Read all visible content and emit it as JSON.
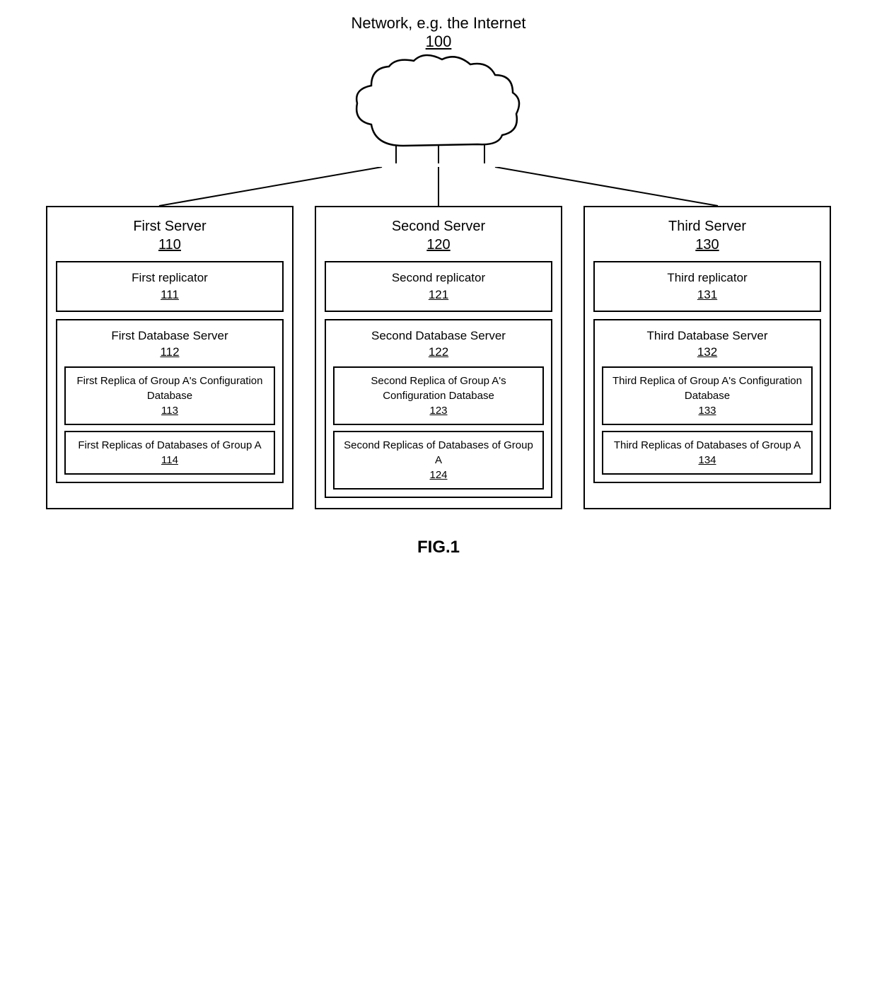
{
  "network": {
    "label": "Network, e.g. the Internet",
    "id": "100"
  },
  "servers": [
    {
      "name": "First Server",
      "id": "110",
      "replicator": {
        "name": "First replicator",
        "id": "111"
      },
      "dbServer": {
        "name": "First Database Server",
        "id": "112",
        "replica_config": {
          "name": "First Replica of Group A's Configuration Database",
          "id": "113"
        },
        "replica_dbs": {
          "name": "First Replicas of Databases of Group A",
          "id": "114"
        }
      }
    },
    {
      "name": "Second Server",
      "id": "120",
      "replicator": {
        "name": "Second replicator",
        "id": "121"
      },
      "dbServer": {
        "name": "Second Database Server",
        "id": "122",
        "replica_config": {
          "name": "Second Replica of Group A's Configuration Database",
          "id": "123"
        },
        "replica_dbs": {
          "name": "Second Replicas of Databases of Group A",
          "id": "124"
        }
      }
    },
    {
      "name": "Third Server",
      "id": "130",
      "replicator": {
        "name": "Third replicator",
        "id": "131"
      },
      "dbServer": {
        "name": "Third Database Server",
        "id": "132",
        "replica_config": {
          "name": "Third Replica of Group A's Configuration Database",
          "id": "133"
        },
        "replica_dbs": {
          "name": "Third Replicas of Databases of Group A",
          "id": "134"
        }
      }
    }
  ],
  "figure_caption": "FIG.1"
}
